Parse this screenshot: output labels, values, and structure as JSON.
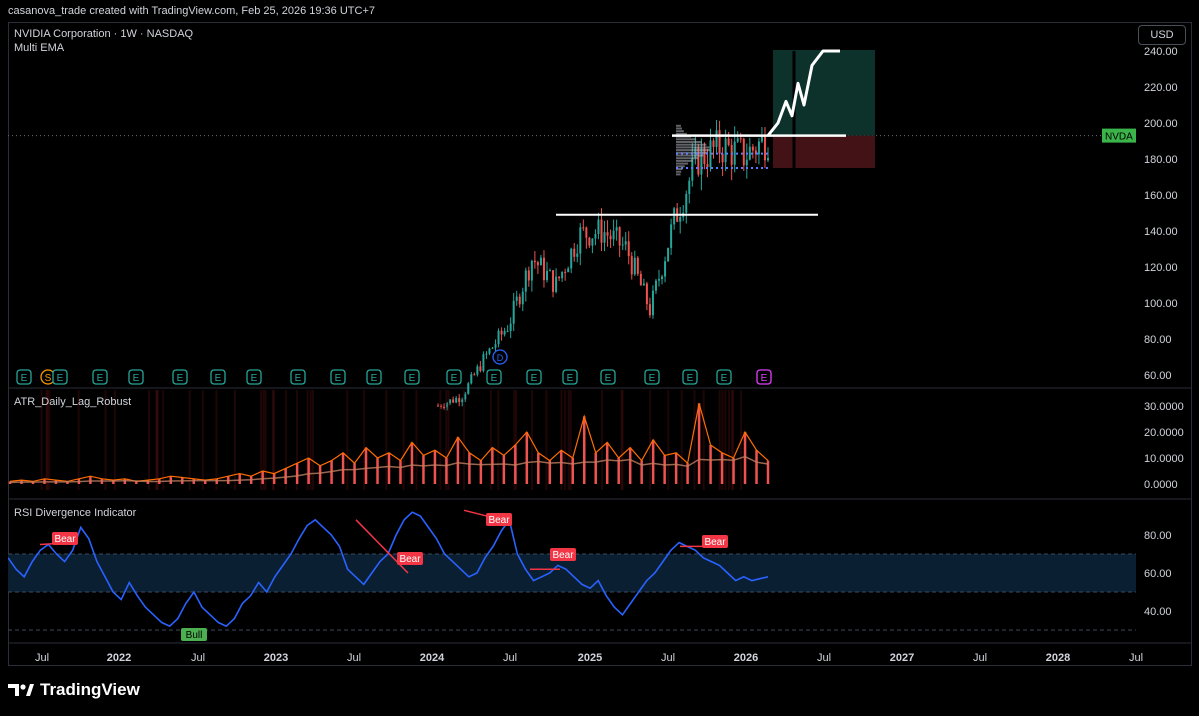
{
  "header": "casanova_trade created with TradingView.com, Feb 25, 2026 19:36 UTC+7",
  "currency_button": "USD",
  "brand": "TradingView",
  "symbol_tag": "NVDA",
  "colors": {
    "up": "#26a69a",
    "down": "#ef5350",
    "rsi": "#2962ff",
    "atr": "#ff6d00",
    "bear": "#f23645",
    "bull": "#4caf50"
  },
  "chart_data": [
    {
      "type": "line",
      "panel": "price",
      "title": "NVIDIA Corporation · 1W · NASDAQ",
      "subtitle": "Multi EMA",
      "y_ticks": [
        "60.00",
        "80.00",
        "100.00",
        "120.00",
        "140.00",
        "160.00",
        "180.00",
        "200.00",
        "220.00",
        "240.00"
      ],
      "ylim": [
        50,
        255
      ],
      "x_ticks": [
        "Jul",
        "2022",
        "Jul",
        "2023",
        "Jul",
        "2024",
        "Jul",
        "2025",
        "Jul",
        "2026",
        "Jul",
        "2027",
        "Jul",
        "2028",
        "Jul"
      ],
      "series": [
        {
          "x": [
            "2023-10",
            "2023-12",
            "2024-02",
            "2024-04",
            "2024-06",
            "2024-08",
            "2024-10",
            "2024-12",
            "2025-02",
            "2025-04",
            "2025-06",
            "2025-08",
            "2025-10",
            "2025-12",
            "2026-02"
          ],
          "values": [
            43,
            48,
            70,
            88,
            125,
            110,
            138,
            140,
            130,
            96,
            145,
            180,
            187,
            182,
            192
          ]
        }
      ],
      "levels": [
        {
          "label": "resistance",
          "value": 193
        },
        {
          "label": "support",
          "value": 149
        }
      ],
      "projection": {
        "from": 193,
        "to": 240
      },
      "event_markers": [
        "E",
        "S",
        "E",
        "E",
        "E",
        "E",
        "E",
        "E",
        "E",
        "E",
        "E",
        "E",
        "E",
        "E",
        "E",
        "E",
        "E",
        "E",
        "E",
        "E",
        "E",
        "E"
      ]
    },
    {
      "type": "bar",
      "panel": "atr",
      "title": "ATR_Daily_Lag_Robust",
      "y_ticks": [
        "0.0000",
        "10.0000",
        "20.0000",
        "30.0000"
      ],
      "ylim": [
        0,
        33
      ],
      "values": [
        1,
        1.5,
        1,
        2,
        1.5,
        1,
        2,
        3,
        2,
        1.5,
        2,
        1,
        1.5,
        2,
        3,
        2.5,
        2,
        1.5,
        2,
        3,
        4,
        3,
        5,
        4,
        6,
        8,
        10,
        7,
        9,
        12,
        8,
        14,
        10,
        12,
        9,
        16,
        11,
        13,
        10,
        18,
        12,
        9,
        14,
        11,
        15,
        20,
        12,
        9,
        13,
        10,
        26,
        12,
        16,
        10,
        14,
        9,
        17,
        11,
        12,
        8,
        31,
        15,
        12,
        10,
        20,
        13,
        9
      ]
    },
    {
      "type": "line",
      "panel": "rsi",
      "title": "RSI Divergence Indicator",
      "y_ticks": [
        "40.00",
        "60.00",
        "80.00"
      ],
      "ylim": [
        25,
        95
      ],
      "band": [
        50,
        70
      ],
      "values": [
        68,
        62,
        58,
        66,
        72,
        75,
        70,
        66,
        72,
        84,
        78,
        66,
        58,
        50,
        46,
        55,
        48,
        42,
        38,
        34,
        32,
        36,
        44,
        50,
        42,
        38,
        34,
        32,
        36,
        44,
        48,
        55,
        50,
        58,
        64,
        70,
        78,
        85,
        88,
        84,
        80,
        74,
        62,
        58,
        54,
        60,
        66,
        70,
        80,
        88,
        92,
        90,
        84,
        78,
        70,
        66,
        62,
        58,
        60,
        68,
        74,
        82,
        88,
        70,
        62,
        56,
        58,
        60,
        64,
        62,
        58,
        54,
        52,
        56,
        48,
        42,
        38,
        44,
        50,
        56,
        60,
        66,
        72,
        76,
        74,
        72,
        68,
        66,
        64,
        60,
        56,
        58,
        56,
        57,
        58
      ],
      "labels": [
        "Bear",
        "Bear",
        "Bear",
        "Bear",
        "Bear",
        "Bull"
      ]
    }
  ]
}
